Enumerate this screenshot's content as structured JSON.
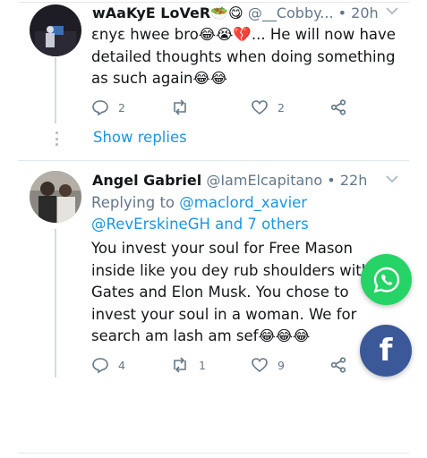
{
  "tweets": [
    {
      "name": "wAaKyE LoVeR🥗😋",
      "handle": "@__Cobby...",
      "dot": "•",
      "time": "20h",
      "body": "ɛnyɛ hwee bro😂😭💔... He will now have detailed thoughts when doing something as such again😂😂",
      "reply_count": "2",
      "retweet_count": "",
      "like_count": "2",
      "show_replies": "Show replies"
    },
    {
      "name": "Angel Gabriel",
      "handle": "@IamElcapitano",
      "dot": "•",
      "time": "22h",
      "replying_prefix": "Replying to",
      "replying_mention": "@maclord_xavier",
      "replying_line2": "@RevErskineGH and 7 others",
      "body": "You invest your soul for Free Mason inside like you dey rub shoulders with Gates and Elon Musk. You chose to invest your soul in a woman. We for search am lash am sef😂😂😂",
      "reply_count": "4",
      "retweet_count": "1",
      "like_count": "9"
    }
  ],
  "floating_buttons": {
    "whatsapp_icon": "whatsapp-icon",
    "facebook_icon": "facebook-icon",
    "facebook_glyph": "f"
  },
  "colors": {
    "link": "#1b95e0",
    "muted": "#657786",
    "whatsapp": "#25d366",
    "facebook": "#3b5998"
  }
}
